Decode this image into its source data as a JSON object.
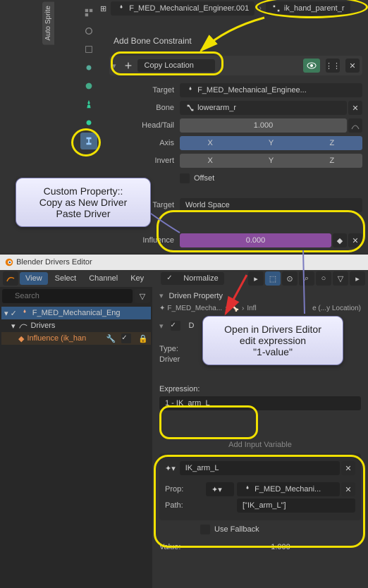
{
  "header": {
    "auto_sprite": "Auto Sprite",
    "armature": "F_MED_Mechanical_Engineer.001",
    "bone": "ik_hand_parent_r"
  },
  "constraint": {
    "add_label": "Add Bone Constraint",
    "name": "Copy Location",
    "target_label": "Target",
    "target_value": "F_MED_Mechanical_Enginee...",
    "bone_label": "Bone",
    "bone_value": "lowerarm_r",
    "headtail_label": "Head/Tail",
    "headtail_value": "1.000",
    "axis_label": "Axis",
    "axes": [
      "X",
      "Y",
      "Z"
    ],
    "invert_label": "Invert",
    "offset_label": "Offset",
    "target2_label": "Target",
    "target2_value": "World Space",
    "influence_label": "Influence",
    "influence_value": "0.000"
  },
  "callouts": {
    "custom_prop": "Custom Property::\nCopy as New Driver\nPaste Driver",
    "drivers_editor": "Open in Drivers Editor\nedit expression\n\"1-value\""
  },
  "drivers": {
    "title": "Blender Drivers Editor",
    "menu": [
      "View",
      "Select",
      "Channel",
      "Key"
    ],
    "normalize": "Normalize",
    "search_placeholder": "Search",
    "tree_root": "F_MED_Mechanical_Eng",
    "tree_drivers": "Drivers",
    "tree_inf": "Influence (ik_han",
    "driven_prop": "Driven Property",
    "bc_root": "F_MED_Mecha...",
    "bc_prop": "Infl",
    "bc_suffix": "e (...y Location)",
    "type_label": "Type:",
    "driver_label": "Driver",
    "expr_label": "Expression:",
    "expr_value": "1 - IK_arm_L",
    "add_var": "Add Input Variable",
    "var_name": "IK_arm_L",
    "prop_label": "Prop:",
    "prop_value": "F_MED_Mechani...",
    "path_label": "Path:",
    "path_value": "[\"IK_arm_L\"]",
    "fallback_label": "Use Fallback",
    "value_label": "Value:",
    "value_value": "1.000",
    "d_checkbox": "D"
  },
  "chart_data": null
}
